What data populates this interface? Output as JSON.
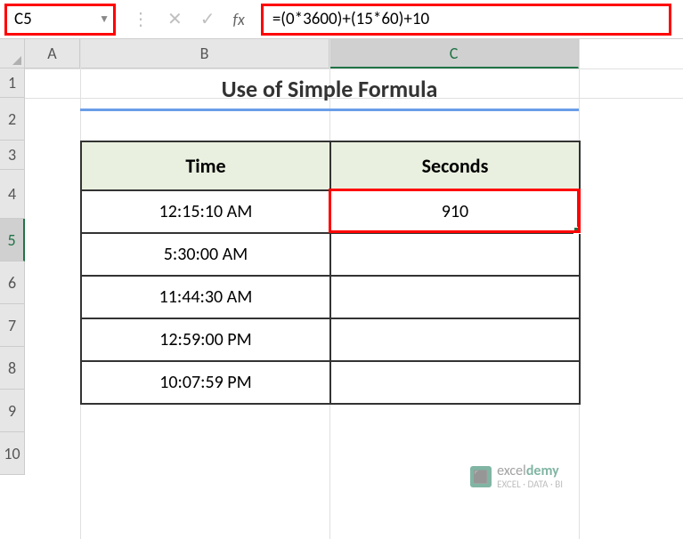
{
  "formula_bar": {
    "cell_reference": "C5",
    "formula": "=(0*3600)+(15*60)+10"
  },
  "columns": [
    "A",
    "B",
    "C"
  ],
  "rows": [
    "1",
    "2",
    "3",
    "4",
    "5",
    "6",
    "7",
    "8",
    "9",
    "10"
  ],
  "active_column": "C",
  "active_row": "5",
  "sheet": {
    "title": "Use of Simple Formula",
    "headers": {
      "time": "Time",
      "seconds": "Seconds"
    },
    "data": [
      {
        "time": "12:15:10 AM",
        "seconds": "910"
      },
      {
        "time": "5:30:00 AM",
        "seconds": ""
      },
      {
        "time": "11:44:30 AM",
        "seconds": ""
      },
      {
        "time": "12:59:00 PM",
        "seconds": ""
      },
      {
        "time": "10:07:59 PM",
        "seconds": ""
      }
    ]
  },
  "watermark": {
    "brand_prefix": "excel",
    "brand_suffix": "demy",
    "tagline": "EXCEL · DATA · BI"
  },
  "chart_data": {
    "type": "table",
    "title": "Use of Simple Formula",
    "columns": [
      "Time",
      "Seconds"
    ],
    "rows": [
      [
        "12:15:10 AM",
        910
      ],
      [
        "5:30:00 AM",
        null
      ],
      [
        "11:44:30 AM",
        null
      ],
      [
        "12:59:00 PM",
        null
      ],
      [
        "10:07:59 PM",
        null
      ]
    ],
    "active_cell": "C5",
    "active_formula": "=(0*3600)+(15*60)+10"
  }
}
